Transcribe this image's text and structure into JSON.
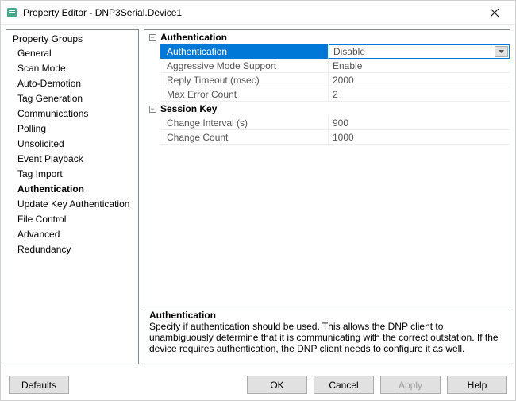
{
  "titlebar": {
    "title": "Property Editor - DNP3Serial.Device1"
  },
  "sidebar": {
    "header": "Property Groups",
    "items": [
      {
        "label": "General"
      },
      {
        "label": "Scan Mode"
      },
      {
        "label": "Auto-Demotion"
      },
      {
        "label": "Tag Generation"
      },
      {
        "label": "Communications"
      },
      {
        "label": "Polling"
      },
      {
        "label": "Unsolicited"
      },
      {
        "label": "Event Playback"
      },
      {
        "label": "Tag Import"
      },
      {
        "label": "Authentication",
        "active": true
      },
      {
        "label": "Update Key Authentication"
      },
      {
        "label": "File Control"
      },
      {
        "label": "Advanced"
      },
      {
        "label": "Redundancy"
      }
    ]
  },
  "grid": {
    "groups": [
      {
        "label": "Authentication",
        "props": [
          {
            "name": "Authentication",
            "value": "Disable",
            "selected": true,
            "dropdown": true
          },
          {
            "name": "Aggressive Mode Support",
            "value": "Enable"
          },
          {
            "name": "Reply Timeout (msec)",
            "value": "2000"
          },
          {
            "name": "Max Error Count",
            "value": "2"
          }
        ]
      },
      {
        "label": "Session Key",
        "props": [
          {
            "name": "Change Interval (s)",
            "value": "900"
          },
          {
            "name": "Change Count",
            "value": "1000"
          }
        ]
      }
    ]
  },
  "description": {
    "title": "Authentication",
    "text": "Specify if authentication should be used. This allows the DNP client to unambiguously determine that it is communicating with the correct outstation. If the device requires authentication, the DNP client needs to configure it as well."
  },
  "buttons": {
    "defaults": "Defaults",
    "ok": "OK",
    "cancel": "Cancel",
    "apply": "Apply",
    "help": "Help"
  }
}
